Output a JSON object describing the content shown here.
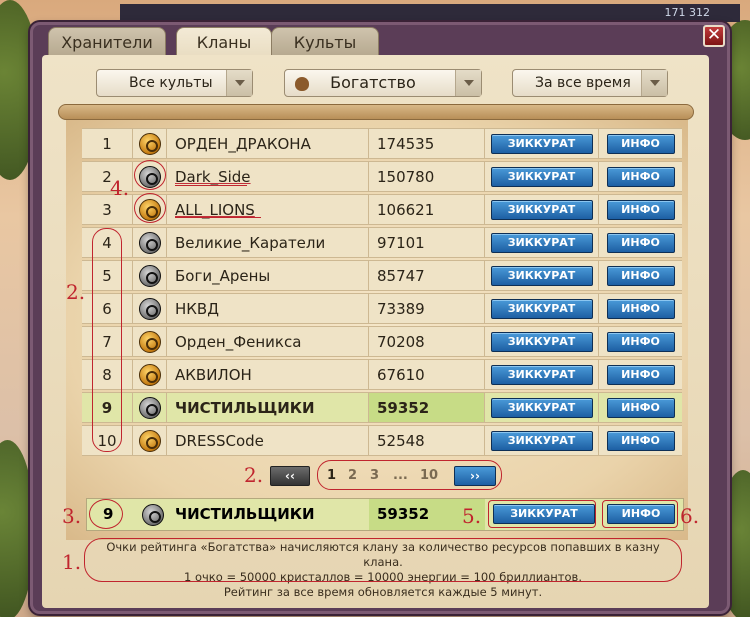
{
  "window": {
    "close_label": "✕",
    "top_value": "171 312"
  },
  "tabs": [
    {
      "label": "Хранители",
      "active": false
    },
    {
      "label": "Кланы",
      "active": true
    },
    {
      "label": "Культы",
      "active": false
    }
  ],
  "filters": {
    "cult": "Все культы",
    "category": "Богатство",
    "period": "За все время"
  },
  "buttons": {
    "ziggurat": "ЗИККУРАТ",
    "info": "ИНФО"
  },
  "rows": [
    {
      "rank": "1",
      "name": "ОРДЕН_ДРАКОНА",
      "score": "174535",
      "emblem": "gold"
    },
    {
      "rank": "2",
      "name": "Dark_Side",
      "score": "150780",
      "emblem": "dark"
    },
    {
      "rank": "3",
      "name": "ALL_LIONS",
      "score": "106621",
      "emblem": "gold"
    },
    {
      "rank": "4",
      "name": "Великие_Каратели",
      "score": "97101",
      "emblem": "dark"
    },
    {
      "rank": "5",
      "name": "Боги_Арены",
      "score": "85747",
      "emblem": "dark"
    },
    {
      "rank": "6",
      "name": "НКВД",
      "score": "73389",
      "emblem": "dark"
    },
    {
      "rank": "7",
      "name": "Орден_Феникса",
      "score": "70208",
      "emblem": "gold"
    },
    {
      "rank": "8",
      "name": "АКВИЛОН",
      "score": "67610",
      "emblem": "gold"
    },
    {
      "rank": "9",
      "name": "ЧИСТИЛЬЩИКИ",
      "score": "59352",
      "emblem": "dark",
      "highlight": true
    },
    {
      "rank": "10",
      "name": "DRESSCode",
      "score": "52548",
      "emblem": "gold"
    }
  ],
  "pager": {
    "prev": "‹‹",
    "next": "››",
    "pages": [
      "1",
      "2",
      "3",
      "...",
      "10"
    ],
    "current": "1"
  },
  "my_clan": {
    "rank": "9",
    "name": "ЧИСТИЛЬЩИКИ",
    "score": "59352"
  },
  "note": {
    "line1": "Очки рейтинга «Богатства» начисляются клану за количество ресурсов попавших в казну клана.",
    "line2": "1 очко = 50000 кристаллов = 10000 энергии = 100 бриллиантов.",
    "line3": "Рейтинг за все время обновляется каждые 5 минут."
  },
  "annotations": [
    "1.",
    "2.",
    "2.",
    "3.",
    "4.",
    "5.",
    "6."
  ],
  "colors": {
    "annotation": "#c0252e",
    "button_blue": "#1d5fa3",
    "highlight_row": "#e0e6a8",
    "frame": "#5b3d57"
  }
}
